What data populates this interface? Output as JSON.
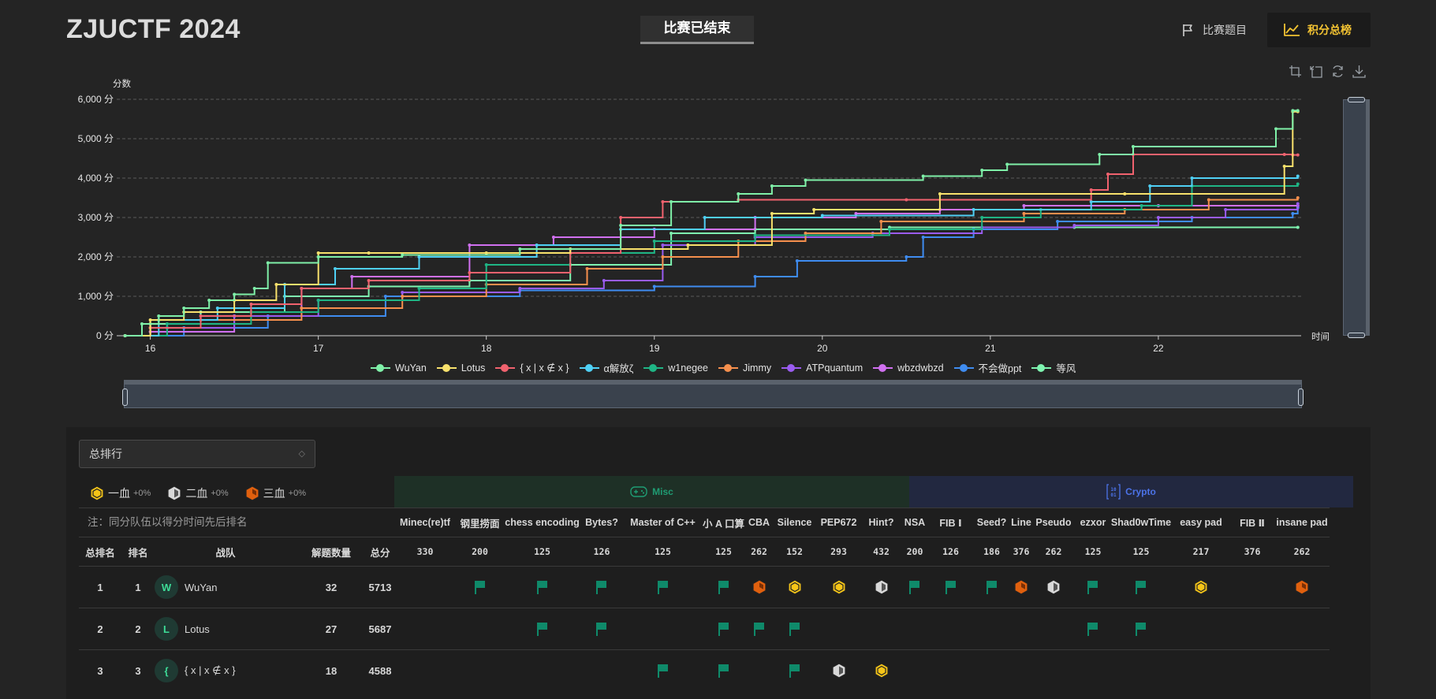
{
  "header": {
    "brand": "ZJUCTF 2024",
    "status": "比赛已结束",
    "nav_challenges": "比赛题目",
    "nav_scoreboard": "积分总榜"
  },
  "toolbox_icons": [
    "zoom-icon",
    "zoom-reset-icon",
    "restore-icon",
    "download-icon"
  ],
  "chart_data": {
    "type": "line",
    "step": true,
    "ylabel": "分数",
    "xlabel": "时间",
    "ylim": [
      0,
      6000
    ],
    "yticks": [
      "0 分",
      "1,000 分",
      "2,000 分",
      "3,000 分",
      "4,000 分",
      "5,000 分",
      "6,000 分"
    ],
    "yvalues": [
      0,
      1000,
      2000,
      3000,
      4000,
      5000,
      6000
    ],
    "xlim": [
      15.8,
      22.85
    ],
    "xticks": [
      "16",
      "17",
      "18",
      "19",
      "20",
      "21",
      "22"
    ],
    "xvalues": [
      16,
      17,
      18,
      19,
      20,
      21,
      22
    ],
    "grid": "horizontal dashed",
    "legend": "bottom",
    "series": [
      {
        "name": "WuYan",
        "color": "#7ff0a8",
        "points": [
          [
            15.85,
            0
          ],
          [
            15.95,
            300
          ],
          [
            16.05,
            500
          ],
          [
            16.2,
            700
          ],
          [
            16.35,
            900
          ],
          [
            16.5,
            1050
          ],
          [
            16.62,
            1200
          ],
          [
            16.7,
            1850
          ],
          [
            17.0,
            2000
          ],
          [
            17.5,
            2050
          ],
          [
            18.2,
            2200
          ],
          [
            18.8,
            2800
          ],
          [
            19.1,
            3400
          ],
          [
            19.5,
            3600
          ],
          [
            19.7,
            3800
          ],
          [
            19.9,
            3950
          ],
          [
            20.6,
            4050
          ],
          [
            20.95,
            4200
          ],
          [
            21.1,
            4350
          ],
          [
            21.65,
            4600
          ],
          [
            21.85,
            4800
          ],
          [
            22.7,
            5250
          ],
          [
            22.8,
            5713
          ],
          [
            22.83,
            5713
          ]
        ]
      },
      {
        "name": "Lotus",
        "color": "#f8e16c",
        "points": [
          [
            15.85,
            0
          ],
          [
            16.0,
            400
          ],
          [
            16.2,
            600
          ],
          [
            16.5,
            900
          ],
          [
            16.75,
            1300
          ],
          [
            17.0,
            2100
          ],
          [
            17.3,
            2100
          ],
          [
            18.0,
            2100
          ],
          [
            18.5,
            2200
          ],
          [
            19.2,
            2300
          ],
          [
            19.7,
            3100
          ],
          [
            19.95,
            3200
          ],
          [
            20.7,
            3600
          ],
          [
            21.8,
            3600
          ],
          [
            22.75,
            4300
          ],
          [
            22.8,
            5687
          ],
          [
            22.83,
            5687
          ]
        ]
      },
      {
        "name": "{ x | x ∉ x }",
        "color": "#f0626e",
        "points": [
          [
            15.85,
            0
          ],
          [
            16.0,
            200
          ],
          [
            16.3,
            500
          ],
          [
            16.6,
            800
          ],
          [
            16.9,
            1200
          ],
          [
            17.3,
            1400
          ],
          [
            17.9,
            1600
          ],
          [
            18.5,
            2100
          ],
          [
            18.8,
            3000
          ],
          [
            19.05,
            3400
          ],
          [
            19.5,
            3450
          ],
          [
            20.5,
            3450
          ],
          [
            21.6,
            3700
          ],
          [
            21.7,
            4100
          ],
          [
            21.85,
            4600
          ],
          [
            22.75,
            4600
          ],
          [
            22.8,
            4588
          ],
          [
            22.83,
            4588
          ]
        ]
      },
      {
        "name": "α解放ζ",
        "color": "#4fd0f5",
        "points": [
          [
            15.85,
            0
          ],
          [
            16.05,
            400
          ],
          [
            16.4,
            700
          ],
          [
            16.8,
            1300
          ],
          [
            17.1,
            1700
          ],
          [
            17.6,
            2000
          ],
          [
            18.3,
            2300
          ],
          [
            18.8,
            2700
          ],
          [
            19.3,
            3000
          ],
          [
            20.0,
            3050
          ],
          [
            20.9,
            3200
          ],
          [
            21.6,
            3400
          ],
          [
            21.95,
            3800
          ],
          [
            22.2,
            4000
          ],
          [
            22.83,
            4050
          ]
        ]
      },
      {
        "name": "w1negee",
        "color": "#1fb585",
        "points": [
          [
            15.85,
            0
          ],
          [
            16.1,
            300
          ],
          [
            16.6,
            600
          ],
          [
            17.0,
            900
          ],
          [
            17.6,
            1200
          ],
          [
            18.0,
            1800
          ],
          [
            18.5,
            2100
          ],
          [
            19.0,
            2400
          ],
          [
            19.6,
            2550
          ],
          [
            20.4,
            2700
          ],
          [
            20.95,
            3000
          ],
          [
            21.3,
            3200
          ],
          [
            21.9,
            3300
          ],
          [
            22.2,
            3800
          ],
          [
            22.83,
            3850
          ]
        ]
      },
      {
        "name": "Jimmy",
        "color": "#f58f4d",
        "points": [
          [
            15.85,
            0
          ],
          [
            16.0,
            200
          ],
          [
            16.3,
            400
          ],
          [
            16.9,
            700
          ],
          [
            17.5,
            1000
          ],
          [
            18.0,
            1300
          ],
          [
            18.6,
            1700
          ],
          [
            19.05,
            2000
          ],
          [
            19.5,
            2400
          ],
          [
            19.9,
            2600
          ],
          [
            20.35,
            2900
          ],
          [
            21.2,
            3100
          ],
          [
            21.8,
            3200
          ],
          [
            22.3,
            3450
          ],
          [
            22.83,
            3500
          ]
        ]
      },
      {
        "name": "ATPquantum",
        "color": "#9a5cf0",
        "points": [
          [
            15.85,
            0
          ],
          [
            16.1,
            200
          ],
          [
            16.5,
            500
          ],
          [
            17.0,
            900
          ],
          [
            17.5,
            1100
          ],
          [
            18.2,
            1200
          ],
          [
            18.7,
            1400
          ],
          [
            19.05,
            2300
          ],
          [
            19.6,
            2500
          ],
          [
            20.3,
            2600
          ],
          [
            20.95,
            2750
          ],
          [
            21.5,
            2800
          ],
          [
            22.0,
            3000
          ],
          [
            22.4,
            3200
          ],
          [
            22.83,
            3350
          ]
        ]
      },
      {
        "name": "wbzdwbzd",
        "color": "#d070f0",
        "points": [
          [
            15.85,
            0
          ],
          [
            16.0,
            100
          ],
          [
            16.5,
            500
          ],
          [
            16.9,
            1200
          ],
          [
            17.2,
            1500
          ],
          [
            17.9,
            2300
          ],
          [
            18.4,
            2500
          ],
          [
            19.0,
            2700
          ],
          [
            19.6,
            3000
          ],
          [
            20.2,
            3100
          ],
          [
            20.7,
            3200
          ],
          [
            21.2,
            3300
          ],
          [
            22.0,
            3300
          ],
          [
            22.83,
            3300
          ]
        ]
      },
      {
        "name": "不会做ppt",
        "color": "#3f8cf0",
        "points": [
          [
            15.85,
            0
          ],
          [
            16.2,
            200
          ],
          [
            16.7,
            500
          ],
          [
            17.4,
            1000
          ],
          [
            18.2,
            1150
          ],
          [
            19.0,
            1250
          ],
          [
            19.6,
            1500
          ],
          [
            19.85,
            1900
          ],
          [
            20.5,
            2000
          ],
          [
            20.6,
            2500
          ],
          [
            20.9,
            2700
          ],
          [
            21.4,
            2900
          ],
          [
            22.2,
            3000
          ],
          [
            22.8,
            3100
          ],
          [
            22.83,
            3250
          ]
        ]
      },
      {
        "name": "等风",
        "color": "#7ef4b0",
        "points": [
          [
            15.85,
            0
          ],
          [
            16.0,
            300
          ],
          [
            16.3,
            600
          ],
          [
            16.8,
            1000
          ],
          [
            17.3,
            1250
          ],
          [
            17.9,
            1400
          ],
          [
            18.5,
            1800
          ],
          [
            19.1,
            2600
          ],
          [
            19.6,
            2700
          ],
          [
            20.4,
            2750
          ],
          [
            21.5,
            2750
          ],
          [
            22.83,
            2750
          ]
        ]
      }
    ]
  },
  "board": {
    "select_value": "总排行",
    "blood": [
      {
        "label": "一血",
        "pct": "+0%"
      },
      {
        "label": "二血",
        "pct": "+0%"
      },
      {
        "label": "三血",
        "pct": "+0%"
      }
    ],
    "note": "注：同分队伍以得分时间先后排名",
    "categories": {
      "misc": "Misc",
      "crypto": "Crypto"
    },
    "col_headers": {
      "total_rank": "总排名",
      "rank": "排名",
      "team": "战队",
      "solves": "解题数量",
      "score": "总分"
    },
    "challenges": [
      {
        "name": "Minec(re)tf",
        "score": "330"
      },
      {
        "name": "钢里捞面",
        "score": "200"
      },
      {
        "name": "chess encoding",
        "score": "125"
      },
      {
        "name": "Bytes?",
        "score": "126"
      },
      {
        "name": "Master of C++",
        "score": "125"
      },
      {
        "name": "小 A 口算",
        "score": "125"
      },
      {
        "name": "CBA",
        "score": "262"
      },
      {
        "name": "Silence",
        "score": "152"
      },
      {
        "name": "PEP672",
        "score": "293"
      },
      {
        "name": "Hint?",
        "score": "432"
      },
      {
        "name": "NSA",
        "score": "200"
      },
      {
        "name": "FIB Ⅰ",
        "score": "126"
      },
      {
        "name": "Seed?",
        "score": "186"
      },
      {
        "name": "Line",
        "score": "376"
      },
      {
        "name": "Pseudo",
        "score": "262"
      },
      {
        "name": "ezxor",
        "score": "125"
      },
      {
        "name": "Shad0wTime",
        "score": "125"
      },
      {
        "name": "easy pad",
        "score": "217"
      },
      {
        "name": "FIB Ⅱ",
        "score": "376"
      },
      {
        "name": "insane pad",
        "score": "262"
      }
    ],
    "rows": [
      {
        "total_rank": "1",
        "rank": "1",
        "avatar": "W",
        "team": "WuYan",
        "solves": "32",
        "score": "5713",
        "marks": [
          "",
          "flag",
          "flag",
          "flag",
          "flag",
          "flag",
          "third",
          "first",
          "first",
          "second",
          "flag",
          "flag",
          "flag",
          "third",
          "second",
          "flag",
          "flag",
          "first",
          "",
          "third"
        ]
      },
      {
        "total_rank": "2",
        "rank": "2",
        "avatar": "L",
        "team": "Lotus",
        "solves": "27",
        "score": "5687",
        "marks": [
          "",
          "",
          "flag",
          "flag",
          "",
          "flag",
          "flag",
          "flag",
          "",
          "",
          "",
          "",
          "",
          "",
          "",
          "flag",
          "flag",
          "",
          "",
          ""
        ]
      },
      {
        "total_rank": "3",
        "rank": "3",
        "avatar": "{",
        "team": "{ x | x ∉ x }",
        "solves": "18",
        "score": "4588",
        "marks": [
          "",
          "",
          "",
          "",
          "flag",
          "flag",
          "",
          "flag",
          "second",
          "first",
          "",
          "",
          "",
          "",
          "",
          "",
          "",
          "",
          "",
          ""
        ]
      }
    ]
  }
}
